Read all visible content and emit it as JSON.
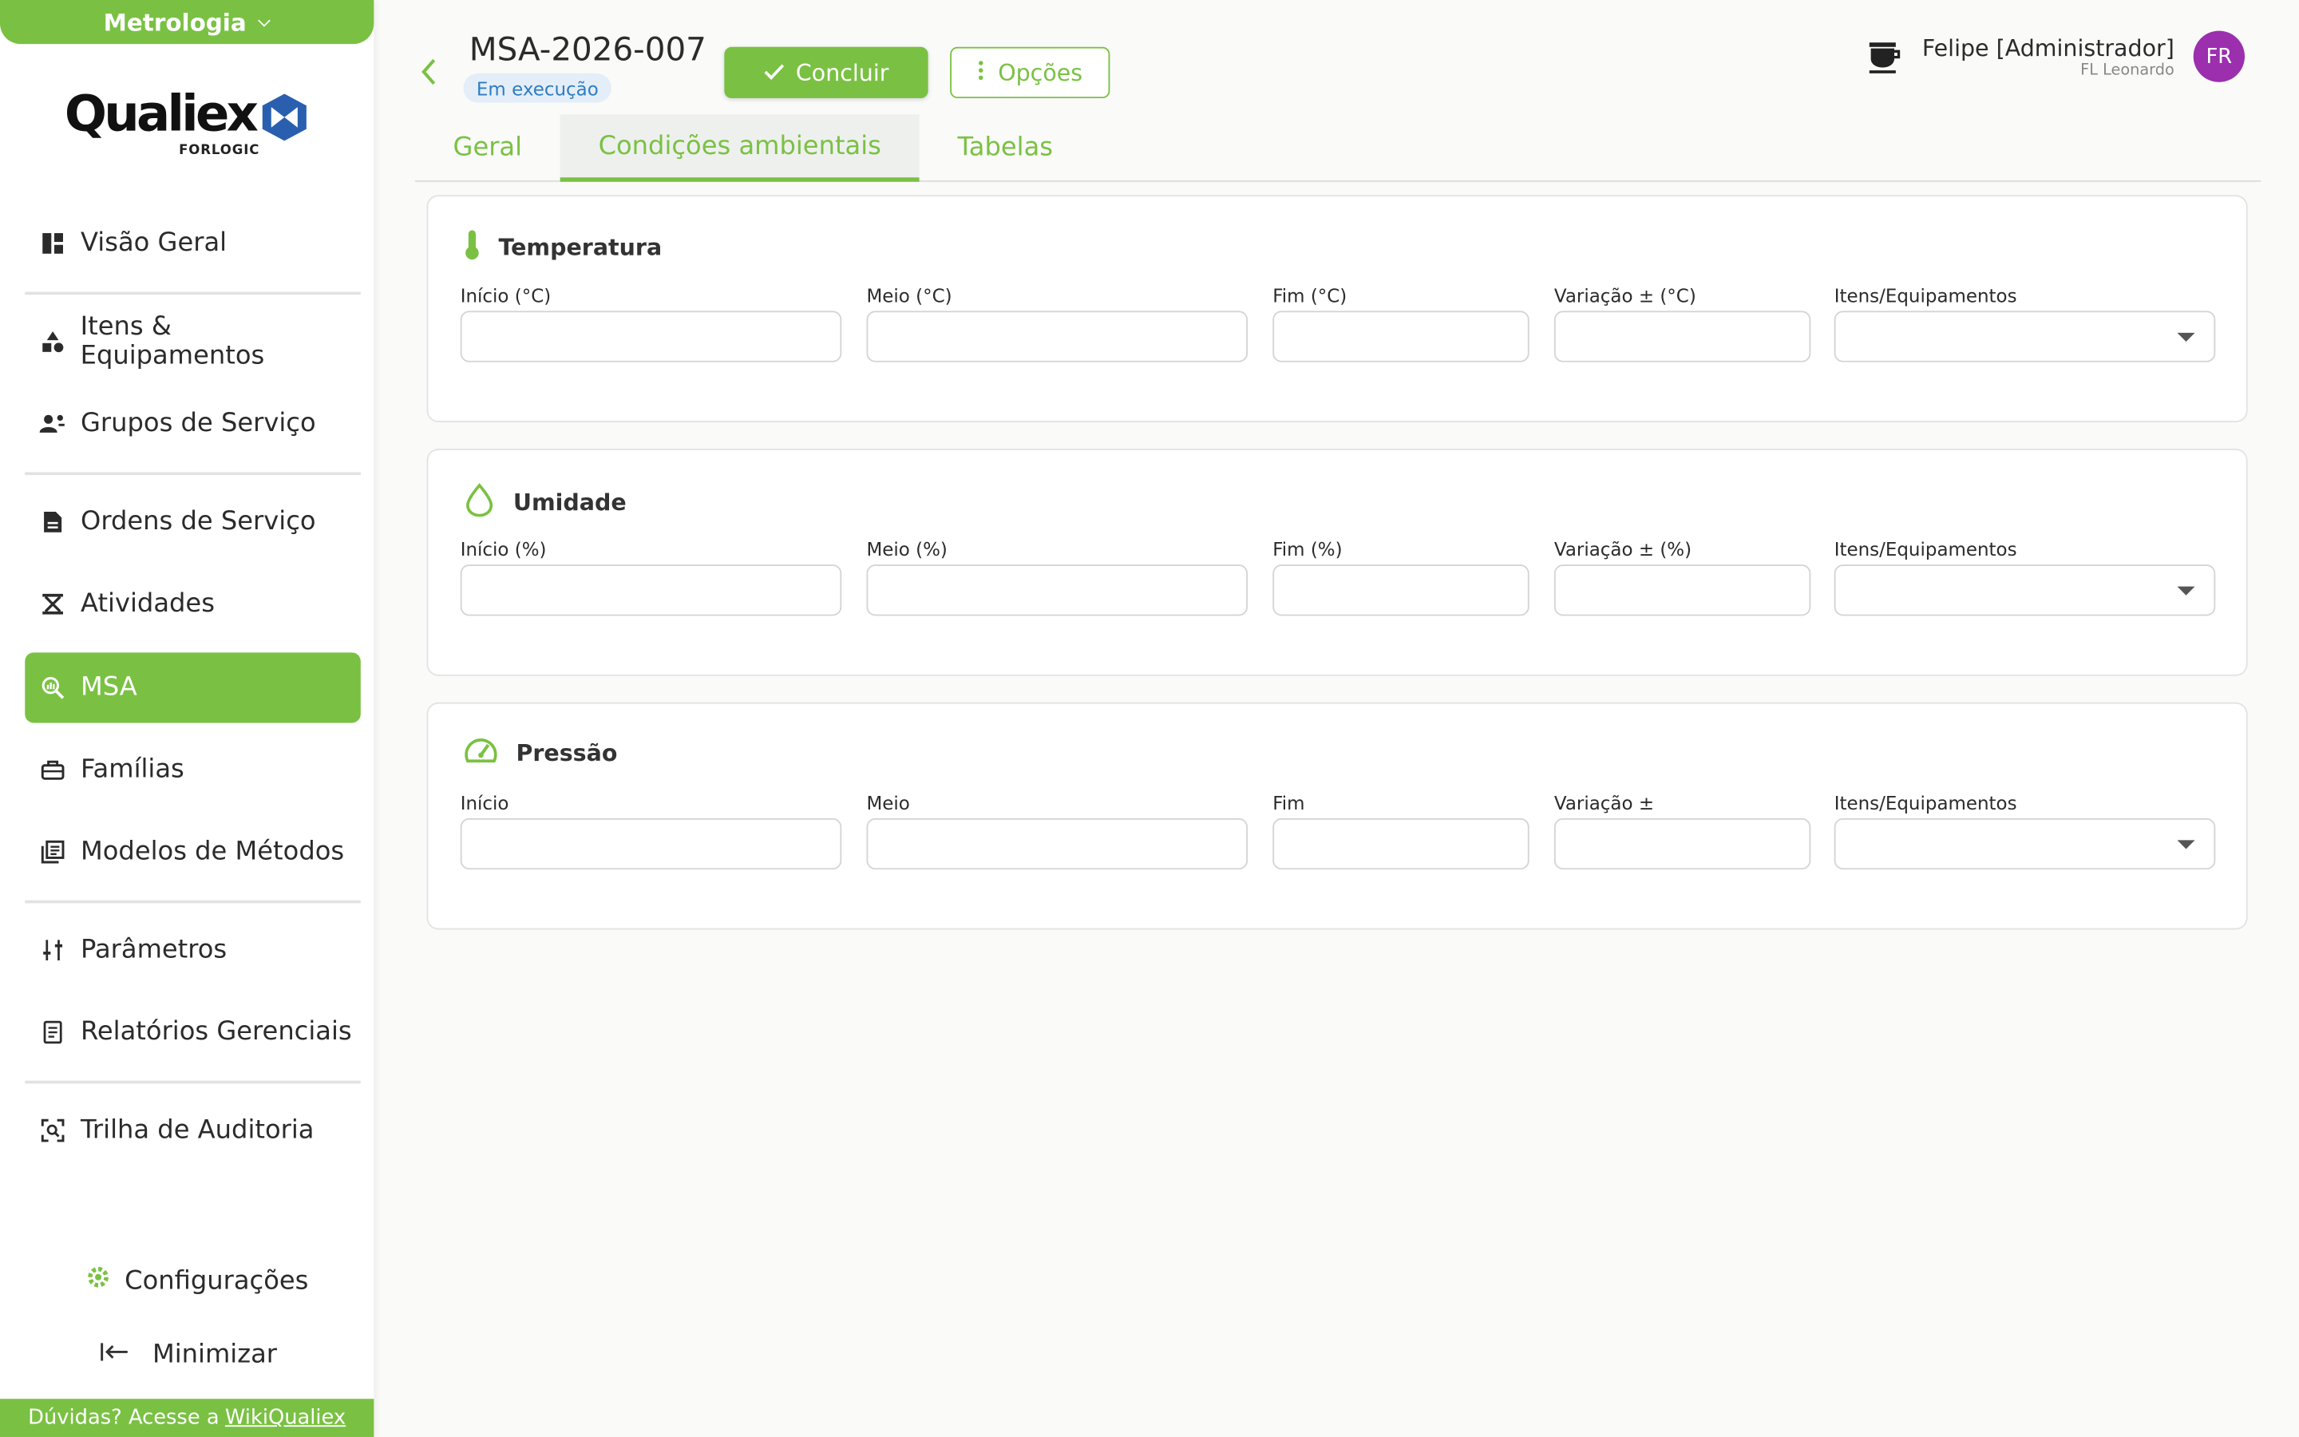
{
  "sidebar": {
    "module": "Metrologia",
    "logo_text": "Qualiex",
    "logo_sub": "FORLOGIC",
    "items": [
      {
        "label": "Visão Geral",
        "icon": "dashboard-icon"
      },
      {
        "label": "Itens & Equipamentos",
        "icon": "shapes-icon"
      },
      {
        "label": "Grupos de Serviço",
        "icon": "group-icon"
      },
      {
        "label": "Ordens de Serviço",
        "icon": "document-icon"
      },
      {
        "label": "Atividades",
        "icon": "hourglass-icon"
      },
      {
        "label": "MSA",
        "icon": "magnify-chart-icon",
        "active": true
      },
      {
        "label": "Famílias",
        "icon": "toolbox-icon"
      },
      {
        "label": "Modelos de Métodos",
        "icon": "library-icon"
      },
      {
        "label": "Parâmetros",
        "icon": "sliders-icon"
      },
      {
        "label": "Relatórios Gerenciais",
        "icon": "report-icon"
      },
      {
        "label": "Trilha de Auditoria",
        "icon": "audit-scan-icon"
      }
    ],
    "config_label": "Configurações",
    "minimize_label": "Minimizar",
    "help_text": "Dúvidas? Acesse a",
    "help_link": "WikiQualiex"
  },
  "header": {
    "title": "MSA-2026-007",
    "status": "Em execução",
    "concluir_label": "Concluir",
    "opcoes_label": "Opções",
    "user_name": "Felipe [Administrador]",
    "user_company": "FL Leonardo",
    "avatar_initials": "FR"
  },
  "tabs": [
    {
      "label": "Geral"
    },
    {
      "label": "Condições ambientais",
      "active": true
    },
    {
      "label": "Tabelas"
    }
  ],
  "sections": [
    {
      "title": "Temperatura",
      "icon": "thermometer-icon",
      "fields": [
        "Início (°C)",
        "Meio (°C)",
        "Fim (°C)",
        "Variação ± (°C)",
        "Itens/Equipamentos"
      ]
    },
    {
      "title": "Umidade",
      "icon": "droplet-icon",
      "fields": [
        "Início (%)",
        "Meio (%)",
        "Fim (%)",
        "Variação ± (%)",
        "Itens/Equipamentos"
      ]
    },
    {
      "title": "Pressão",
      "icon": "gauge-icon",
      "fields": [
        "Início",
        "Meio",
        "Fim",
        "Variação ±",
        "Itens/Equipamentos"
      ]
    }
  ],
  "colors": {
    "accent": "#7ac143",
    "status_bg": "#e4eef8",
    "status_text": "#2e7dc2",
    "avatar": "#9b2fae"
  }
}
